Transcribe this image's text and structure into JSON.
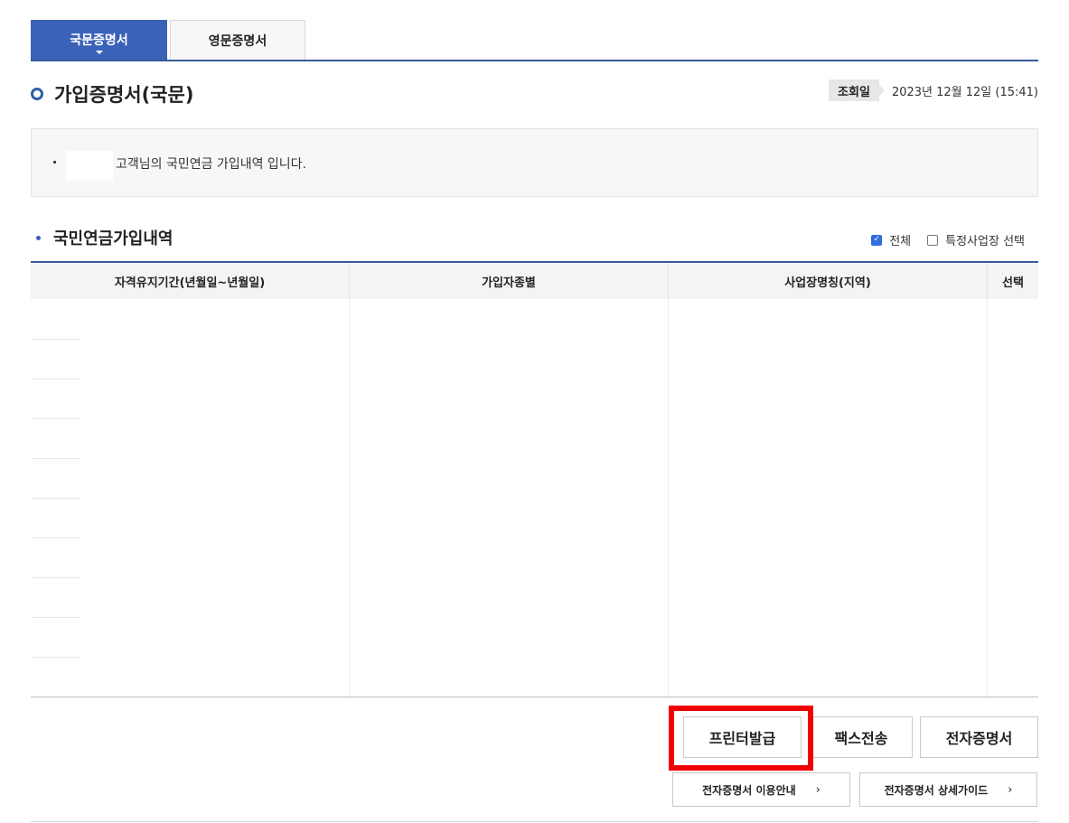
{
  "tabs": [
    {
      "label": "국문증명서",
      "active": true
    },
    {
      "label": "영문증명서",
      "active": false
    }
  ],
  "page_title": "가입증명서(국문)",
  "inquiry": {
    "label": "조회일",
    "date": "2023년 12월 12일 (15:41)"
  },
  "info_message": "고객님의 국민연금 가입내역 입니다.",
  "section": {
    "title": "국민연금가입내역"
  },
  "filters": [
    {
      "label": "전체",
      "checked": true
    },
    {
      "label": "특정사업장 선택",
      "checked": false
    }
  ],
  "table": {
    "headers": [
      "자격유지기간(년월일~년월일)",
      "가입자종별",
      "사업장명칭(지역)",
      "선택"
    ],
    "rows": []
  },
  "buttons": {
    "print": "프린터발급",
    "fax": "팩스전송",
    "electronic": "전자증명서",
    "guide": "전자증명서 이용안내",
    "detail_guide": "전자증명서 상세가이드"
  },
  "colors": {
    "accent": "#3a62b8",
    "highlight": "#f00000"
  }
}
